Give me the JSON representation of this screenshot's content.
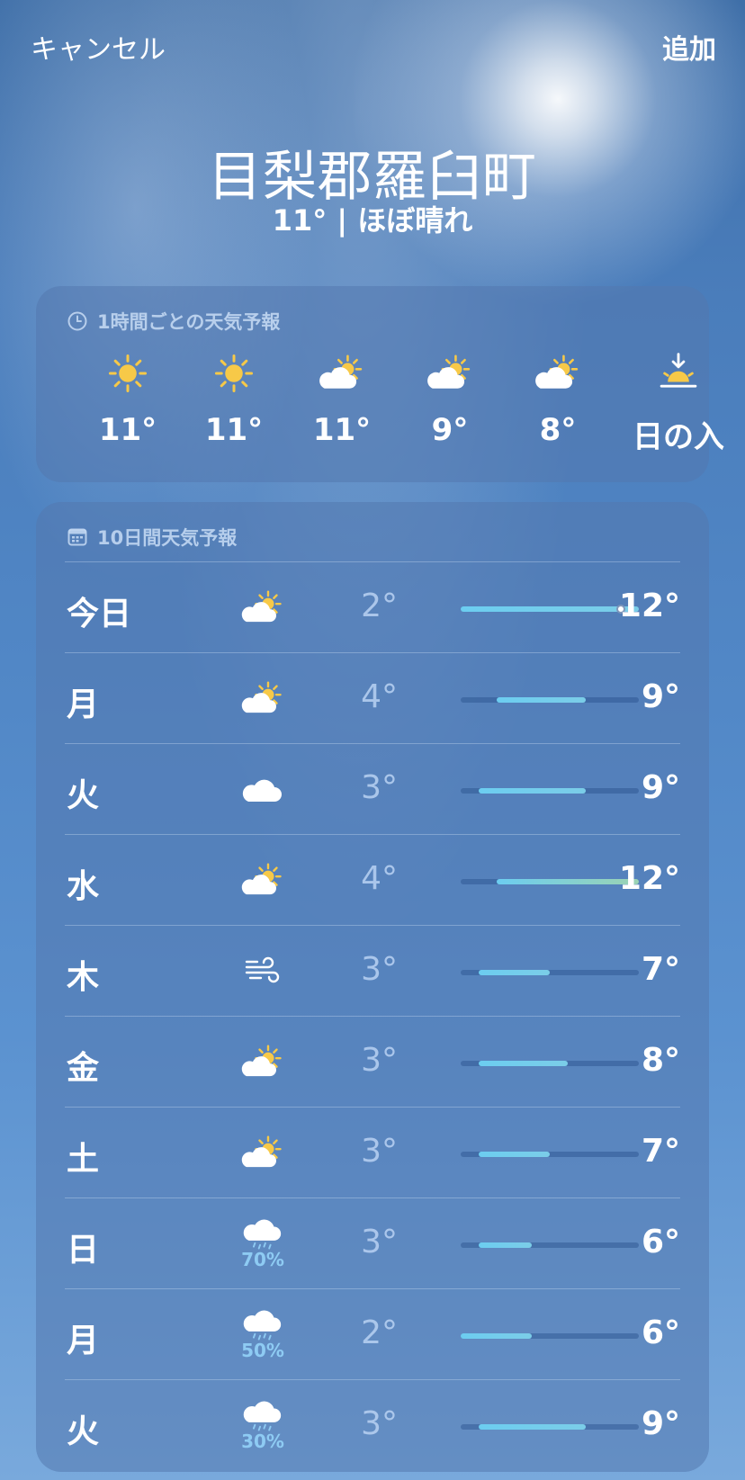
{
  "header": {
    "cancel_label": "キャンセル",
    "add_label": "追加"
  },
  "location": {
    "name": "目梨郡羅臼町",
    "summary": "11° | ほぼ晴れ"
  },
  "hourly": {
    "title": "1時間ごとの天気予報",
    "icon": "clock-icon",
    "items": [
      {
        "icon": "sun-icon",
        "label": "11°"
      },
      {
        "icon": "sun-icon",
        "label": "11°"
      },
      {
        "icon": "partly-cloudy-icon",
        "label": "11°"
      },
      {
        "icon": "partly-cloudy-icon",
        "label": "9°"
      },
      {
        "icon": "partly-cloudy-icon",
        "label": "8°"
      },
      {
        "icon": "sunset-icon",
        "label": "日の入"
      }
    ]
  },
  "daily": {
    "title": "10日間天気予報",
    "icon": "calendar-icon",
    "range": {
      "min": 2,
      "max": 12
    },
    "days": [
      {
        "day": "今日",
        "icon": "partly-cloudy-icon",
        "low": "2°",
        "high": "12°",
        "lo": 2,
        "hi": 12,
        "current": 11
      },
      {
        "day": "月",
        "icon": "partly-cloudy-icon",
        "low": "4°",
        "high": "9°",
        "lo": 4,
        "hi": 9
      },
      {
        "day": "火",
        "icon": "cloud-icon",
        "low": "3°",
        "high": "9°",
        "lo": 3,
        "hi": 9
      },
      {
        "day": "水",
        "icon": "partly-cloudy-icon",
        "low": "4°",
        "high": "12°",
        "lo": 4,
        "hi": 12
      },
      {
        "day": "木",
        "icon": "wind-icon",
        "low": "3°",
        "high": "7°",
        "lo": 3,
        "hi": 7
      },
      {
        "day": "金",
        "icon": "partly-cloudy-icon",
        "low": "3°",
        "high": "8°",
        "lo": 3,
        "hi": 8
      },
      {
        "day": "土",
        "icon": "partly-cloudy-icon",
        "low": "3°",
        "high": "7°",
        "lo": 3,
        "hi": 7
      },
      {
        "day": "日",
        "icon": "rain-icon",
        "precip": "70%",
        "low": "3°",
        "high": "6°",
        "lo": 3,
        "hi": 6
      },
      {
        "day": "月",
        "icon": "rain-icon",
        "precip": "50%",
        "low": "2°",
        "high": "6°",
        "lo": 2,
        "hi": 6
      },
      {
        "day": "火",
        "icon": "rain-icon",
        "precip": "30%",
        "low": "3°",
        "high": "9°",
        "lo": 3,
        "hi": 9
      }
    ]
  },
  "colors": {
    "sun": "#f7c948",
    "cloud": "#ffffff",
    "bar": "#6ccdf0",
    "precip": "#8ecbf3"
  }
}
